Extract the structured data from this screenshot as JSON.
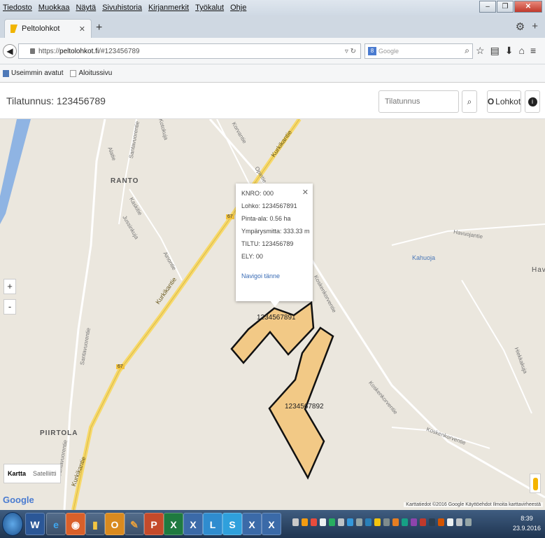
{
  "browser": {
    "menu": [
      "Tiedosto",
      "Muokkaa",
      "Näytä",
      "Sivuhistoria",
      "Kirjanmerkit",
      "Työkalut",
      "Ohje"
    ],
    "tab_title": "Peltolohkot",
    "url_prefix": "https://",
    "url_domain": "peltolohkot.fi",
    "url_hash": "/#123456789",
    "search_placeholder": "Google",
    "bookmarks": [
      "Useimmin avatut",
      "Aloitussivu"
    ]
  },
  "app": {
    "title": "Tilatunnus: 123456789",
    "search_placeholder": "Tilatunnus",
    "lohkot_label": "Lohkot"
  },
  "map": {
    "places": [
      "RANTO",
      "PIIRTOLA",
      "Havu"
    ],
    "water_label": "Kahuoja",
    "roads": {
      "kurkikantie": "Kurkikantie",
      "santavuorentie": "Santavuorentie",
      "koskenkorventie": "Koskenkorventie",
      "havuojantie": "Havuojantie",
      "opintie": "Opintie",
      "korvantie": "Korvantie",
      "kotokuja": "Kotokuja",
      "kaskitie": "Kaskitie",
      "jussinkuja": "Jussinkuja",
      "hiekkakuja": "Hiekkakuja",
      "alatie": "Alatie",
      "ainontie": "Ainontie",
      "road_number": "67"
    },
    "parcels": [
      "1234567891",
      "1234567892"
    ],
    "popup": {
      "knro": "KNRO: 000",
      "lohko": "Lohko: 1234567891",
      "pinta_ala": "Pinta-ala: 0.56 ha",
      "ymparysmitta": "Ympärysmitta: 333.33 m",
      "tiltu": "TILTU: 123456789",
      "ely": "ELY: 00",
      "navigate": "Navigoi tänne"
    },
    "zoom_in": "+",
    "zoom_out": "-",
    "map_types": [
      "Kartta",
      "Satelliitti"
    ],
    "google_logo": "Google",
    "attribution": "Karttatiedot ©2016 Google   Käyttöehdot   Ilmoita karttavirheestä"
  },
  "taskbar": {
    "time": "8:39",
    "date": "23.9.2016"
  },
  "colors": {
    "parcel_fill": "#f2c986",
    "parcel_stroke": "#111111",
    "main_road": "#f7d96a",
    "water": "#8fb4e3",
    "link": "#3a6cb5"
  }
}
